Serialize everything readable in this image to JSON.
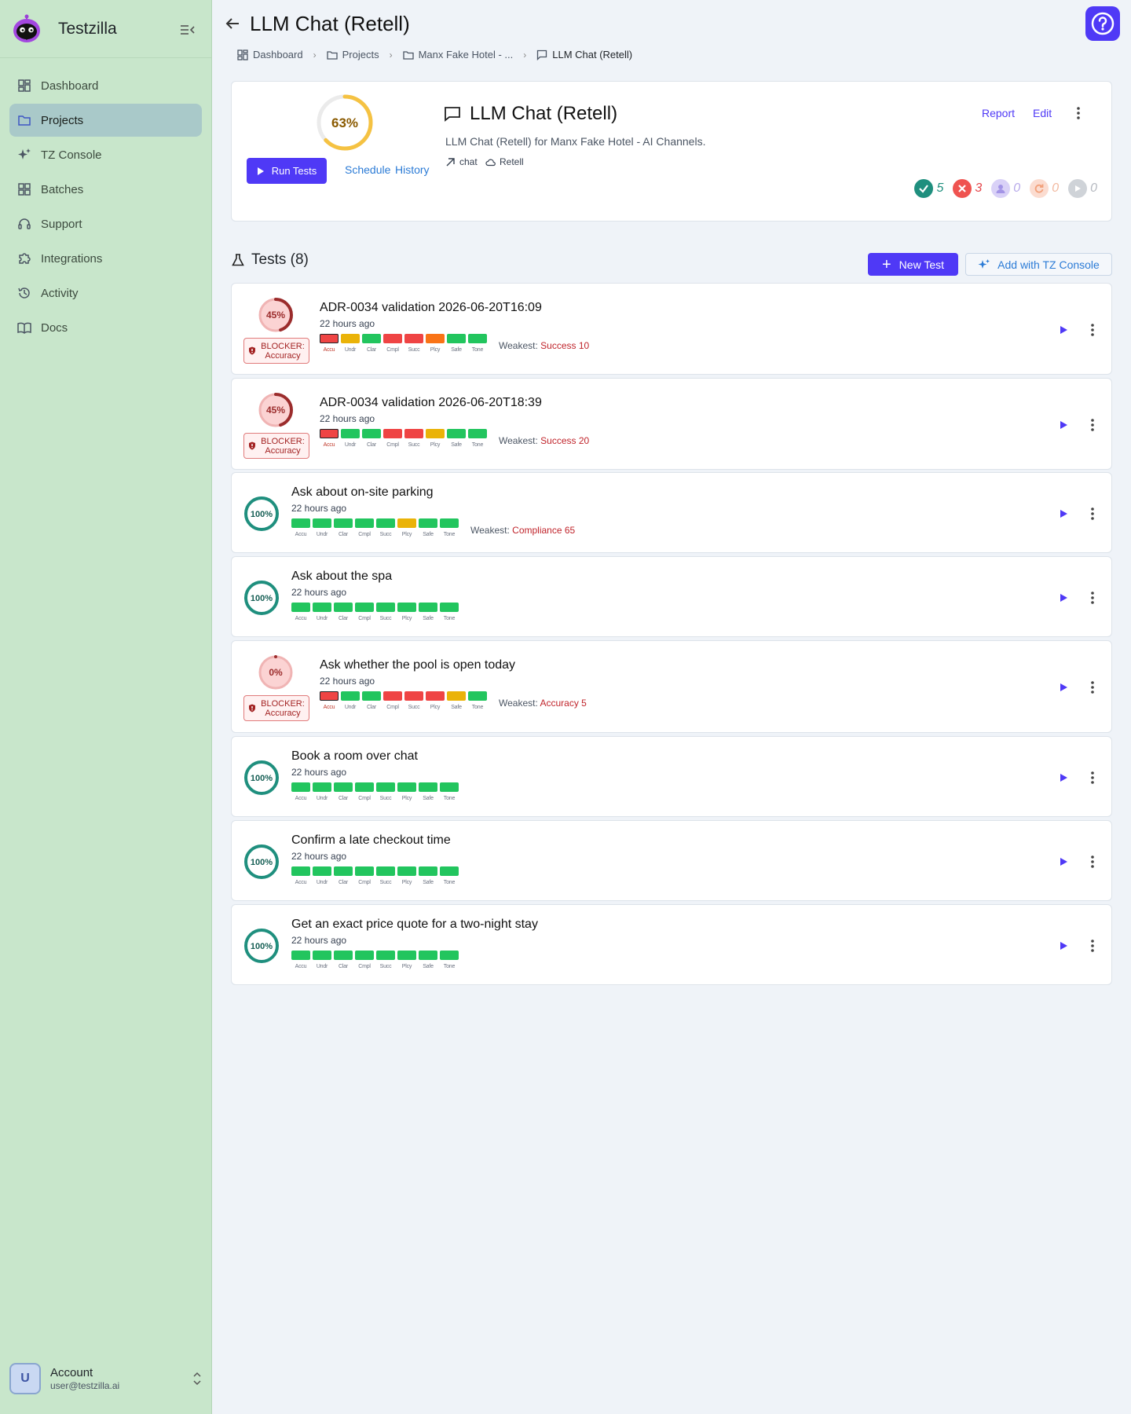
{
  "app": {
    "name": "Testzilla"
  },
  "sidebar": {
    "items": [
      {
        "label": "Dashboard",
        "icon": "dashboard-icon"
      },
      {
        "label": "Projects",
        "icon": "folder-icon"
      },
      {
        "label": "TZ Console",
        "icon": "sparkle-icon"
      },
      {
        "label": "Batches",
        "icon": "grid-icon"
      },
      {
        "label": "Support",
        "icon": "headset-icon"
      },
      {
        "label": "Integrations",
        "icon": "puzzle-icon"
      },
      {
        "label": "Activity",
        "icon": "history-icon"
      },
      {
        "label": "Docs",
        "icon": "book-icon"
      }
    ],
    "active": "Projects",
    "account": {
      "initial": "U",
      "name": "Account",
      "email": "user@testzilla.ai"
    }
  },
  "header": {
    "title": "LLM Chat (Retell)"
  },
  "breadcrumb": [
    {
      "label": "Dashboard"
    },
    {
      "label": "Projects"
    },
    {
      "label": "Manx Fake Hotel - ..."
    },
    {
      "label": "LLM Chat (Retell)"
    }
  ],
  "project": {
    "score": 63,
    "score_label": "63%",
    "run_label": "Run Tests",
    "schedule_label": "Schedule",
    "history_label": "History",
    "name": "LLM Chat (Retell)",
    "description": "LLM Chat (Retell) for Manx Fake Hotel - AI Channels.",
    "tags": [
      {
        "label": "chat",
        "icon": "arrow-up-right-icon"
      },
      {
        "label": "Retell",
        "icon": "cloud-icon"
      }
    ],
    "report_label": "Report",
    "edit_label": "Edit",
    "stats": {
      "passed": "5",
      "failed": "3",
      "pending": "0",
      "running": "0",
      "not_run": "0"
    }
  },
  "tests": {
    "heading": "Tests (8)",
    "new_label": "New Test",
    "tz_label": "Add with TZ Console",
    "metric_labels": [
      "Accu",
      "Undr",
      "Clar",
      "Cmpl",
      "Succ",
      "Plcy",
      "Safe",
      "Tone"
    ],
    "weakest_prefix": "Weakest:",
    "colors": {
      "green": "#22c55e",
      "red": "#ef4444",
      "orange": "#f97316",
      "yellow": "#eab308"
    },
    "items": [
      {
        "name": "ADR-0034 validation 2026-06-20T16:09",
        "ago": "22 hours ago",
        "score": 45,
        "score_label": "45%",
        "blocker": true,
        "blocker_label": "BLOCKER:",
        "blocker_metric": "Accuracy",
        "metrics": [
          "red",
          "yellow",
          "green",
          "red",
          "red",
          "orange",
          "green",
          "green"
        ],
        "weakest": "Success 10"
      },
      {
        "name": "ADR-0034 validation 2026-06-20T18:39",
        "ago": "22 hours ago",
        "score": 45,
        "score_label": "45%",
        "blocker": true,
        "blocker_label": "BLOCKER:",
        "blocker_metric": "Accuracy",
        "metrics": [
          "red",
          "green",
          "green",
          "red",
          "red",
          "yellow",
          "green",
          "green"
        ],
        "weakest": "Success 20"
      },
      {
        "name": "Ask about on-site parking",
        "ago": "22 hours ago",
        "score": 100,
        "score_label": "100%",
        "blocker": false,
        "metrics": [
          "green",
          "green",
          "green",
          "green",
          "green",
          "yellow",
          "green",
          "green"
        ],
        "weakest": "Compliance 65"
      },
      {
        "name": "Ask about the spa",
        "ago": "22 hours ago",
        "score": 100,
        "score_label": "100%",
        "blocker": false,
        "metrics": [
          "green",
          "green",
          "green",
          "green",
          "green",
          "green",
          "green",
          "green"
        ],
        "weakest": ""
      },
      {
        "name": "Ask whether the pool is open today",
        "ago": "22 hours ago",
        "score": 0,
        "score_label": "0%",
        "blocker": true,
        "blocker_label": "BLOCKER:",
        "blocker_metric": "Accuracy",
        "metrics": [
          "red",
          "green",
          "green",
          "red",
          "red",
          "red",
          "yellow",
          "green"
        ],
        "weakest": "Accuracy 5"
      },
      {
        "name": "Book a room over chat",
        "ago": "22 hours ago",
        "score": 100,
        "score_label": "100%",
        "blocker": false,
        "metrics": [
          "green",
          "green",
          "green",
          "green",
          "green",
          "green",
          "green",
          "green"
        ],
        "weakest": ""
      },
      {
        "name": "Confirm a late checkout time",
        "ago": "22 hours ago",
        "score": 100,
        "score_label": "100%",
        "blocker": false,
        "metrics": [
          "green",
          "green",
          "green",
          "green",
          "green",
          "green",
          "green",
          "green"
        ],
        "weakest": ""
      },
      {
        "name": "Get an exact price quote for a two-night stay",
        "ago": "22 hours ago",
        "score": 100,
        "score_label": "100%",
        "blocker": false,
        "metrics": [
          "green",
          "green",
          "green",
          "green",
          "green",
          "green",
          "green",
          "green"
        ],
        "weakest": ""
      }
    ]
  }
}
